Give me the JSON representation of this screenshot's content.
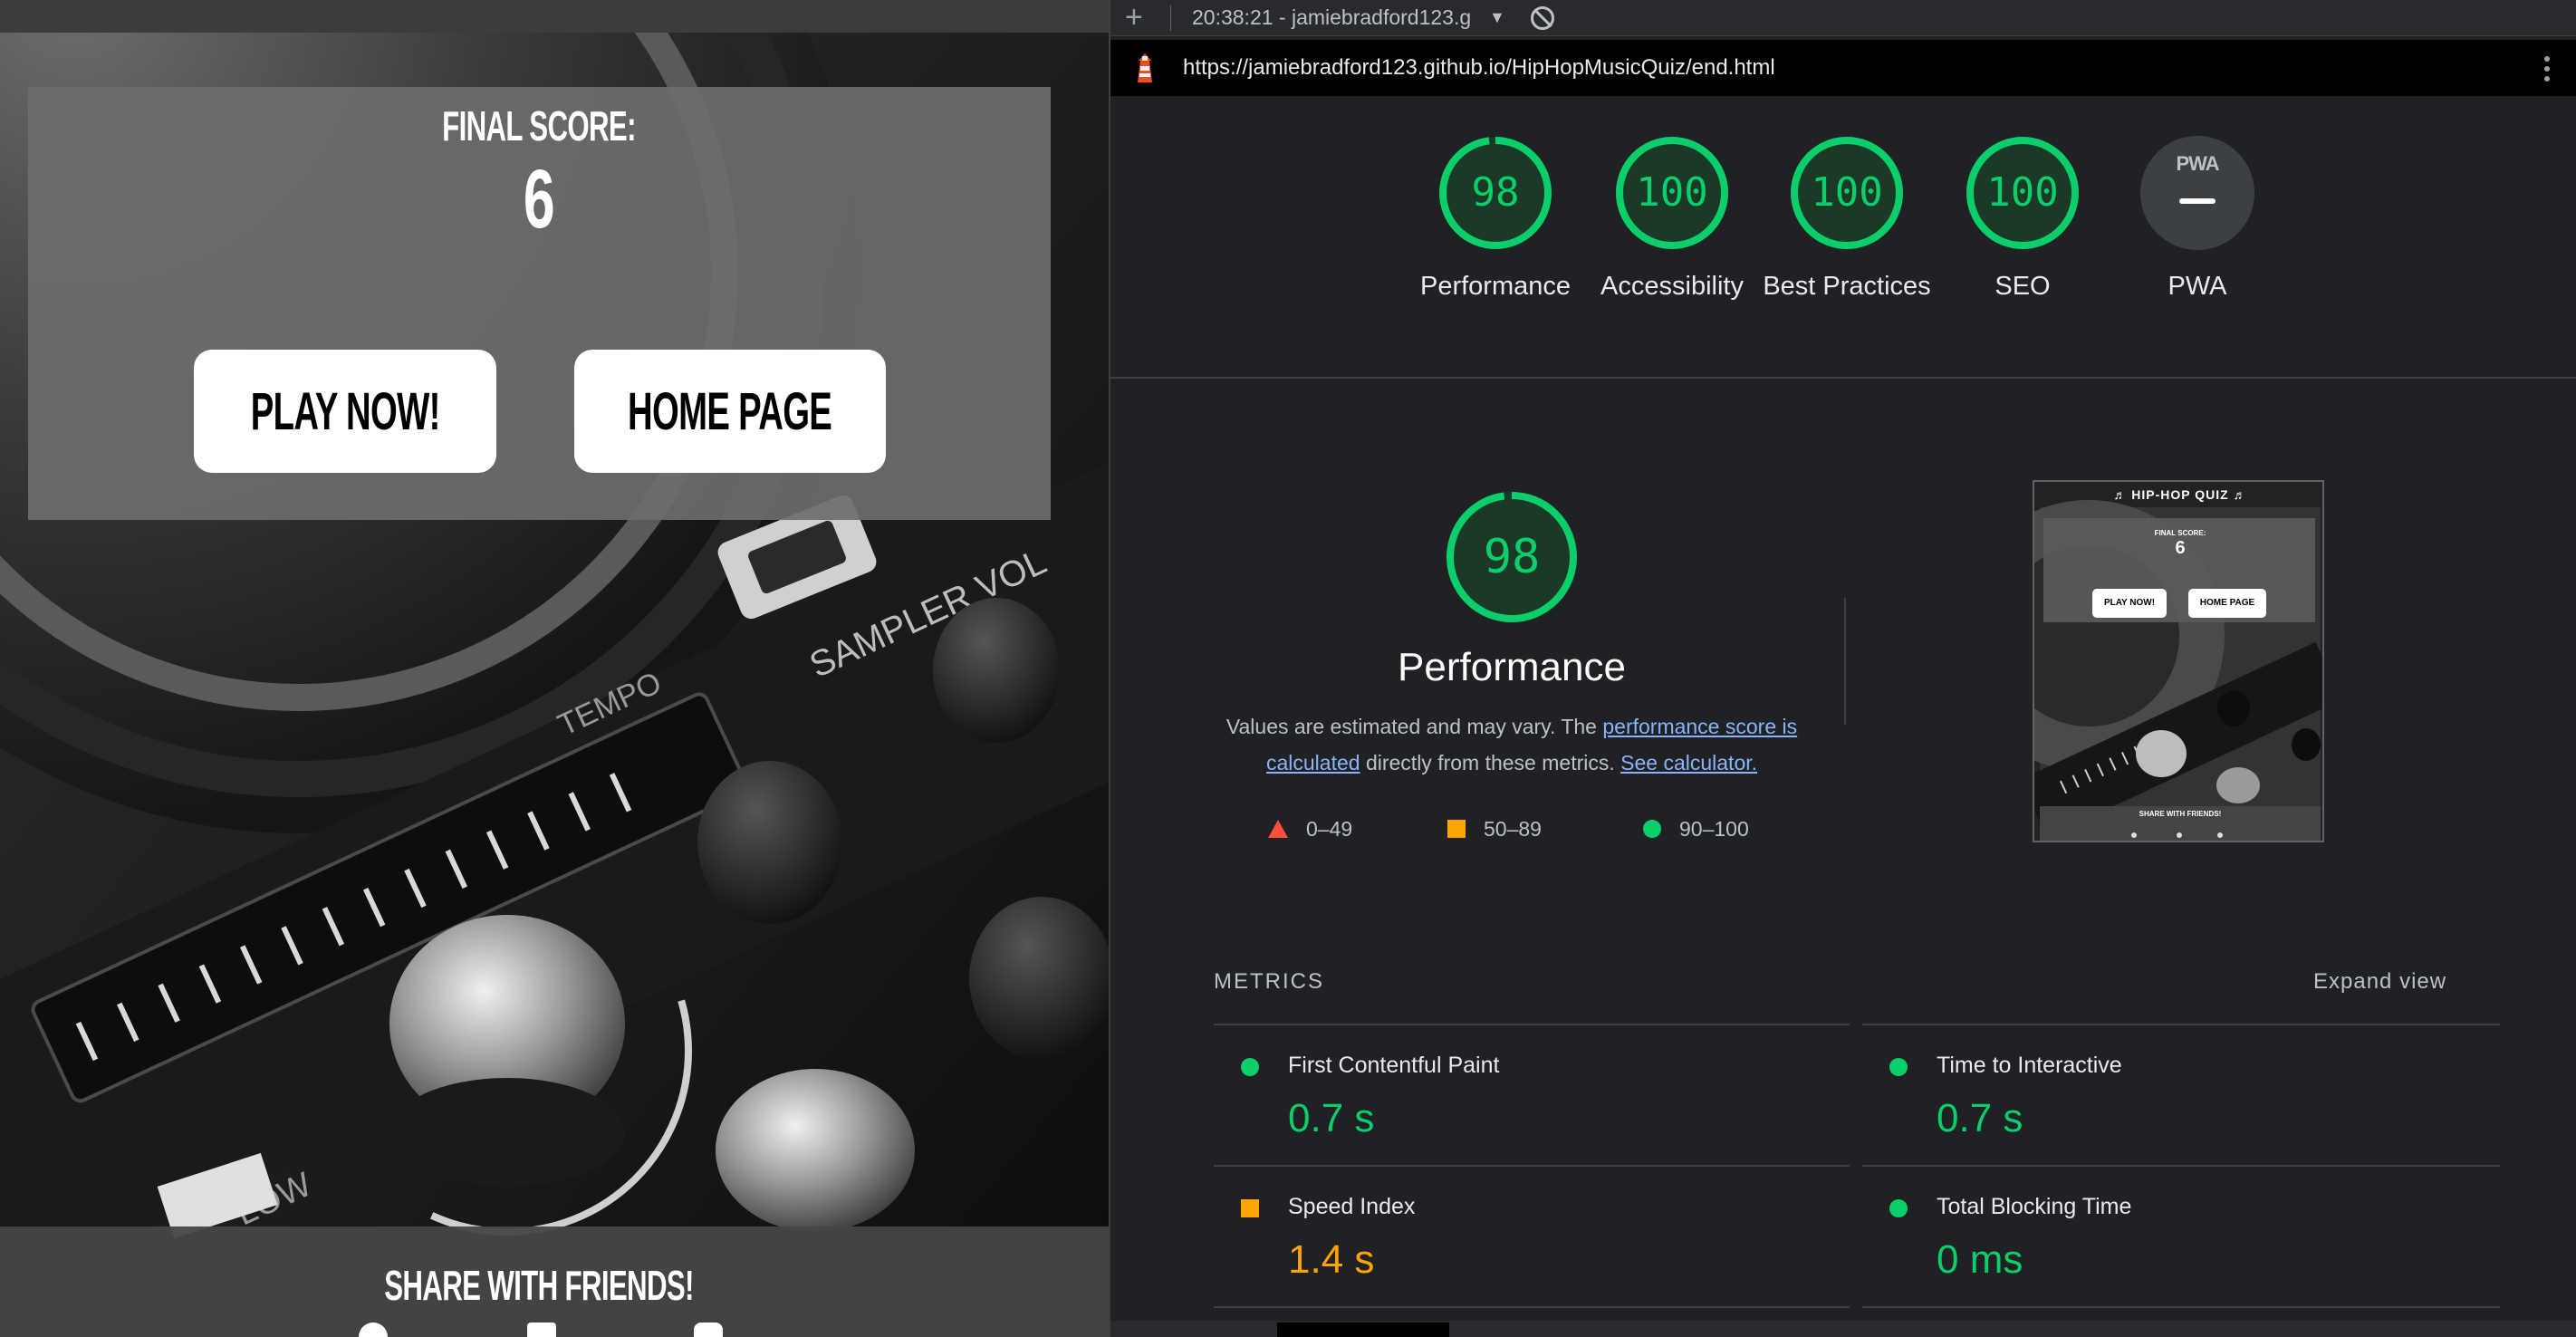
{
  "quiz": {
    "final_score_label": "FINAL SCORE:",
    "final_score_value": "6",
    "play_button": "PLAY NOW!",
    "home_button": "HOME PAGE",
    "share_title": "SHARE WITH FRIENDS!",
    "share_icons": [
      "facebook-icon",
      "linkedin-icon",
      "instagram-icon"
    ]
  },
  "devtools": {
    "toolbar": {
      "add_label": "+",
      "report_selector": "20:38:21 - jamiebradford123.g",
      "caret": "▼"
    },
    "report_url": "https://jamiebradford123.github.io/HipHopMusicQuiz/end.html",
    "categories": [
      {
        "label": "Performance",
        "score": "98",
        "value": 98
      },
      {
        "label": "Accessibility",
        "score": "100",
        "value": 100
      },
      {
        "label": "Best Practices",
        "score": "100",
        "value": 100
      },
      {
        "label": "SEO",
        "score": "100",
        "value": 100
      },
      {
        "label": "PWA",
        "score": "—",
        "badge": "PWA"
      }
    ],
    "performance": {
      "score": "98",
      "value": 98,
      "title": "Performance",
      "desc_prefix": "Values are estimated and may vary. The ",
      "desc_link1": "performance score is calculated",
      "desc_middle": " directly from these metrics. ",
      "desc_link2": "See calculator.",
      "legend": [
        {
          "range": "0–49",
          "status": "fail"
        },
        {
          "range": "50–89",
          "status": "average"
        },
        {
          "range": "90–100",
          "status": "pass"
        }
      ]
    },
    "thumbnail": {
      "title": "♬ HIP-HOP QUIZ ♬",
      "final_score_label": "FINAL SCORE:",
      "final_score_value": "6",
      "play_button": "PLAY NOW!",
      "home_button": "HOME PAGE",
      "share_title": "SHARE WITH FRIENDS!"
    },
    "metrics": {
      "heading": "METRICS",
      "expand_label": "Expand view",
      "items": [
        {
          "title": "First Contentful Paint",
          "value": "0.7 s",
          "status": "pass"
        },
        {
          "title": "Time to Interactive",
          "value": "0.7 s",
          "status": "pass"
        },
        {
          "title": "Speed Index",
          "value": "1.4 s",
          "status": "average"
        },
        {
          "title": "Total Blocking Time",
          "value": "0 ms",
          "status": "pass"
        }
      ]
    },
    "colors": {
      "pass": "#0cce6b",
      "average": "#ffa400",
      "fail": "#ff4e42",
      "link": "#8ab4f8"
    }
  }
}
